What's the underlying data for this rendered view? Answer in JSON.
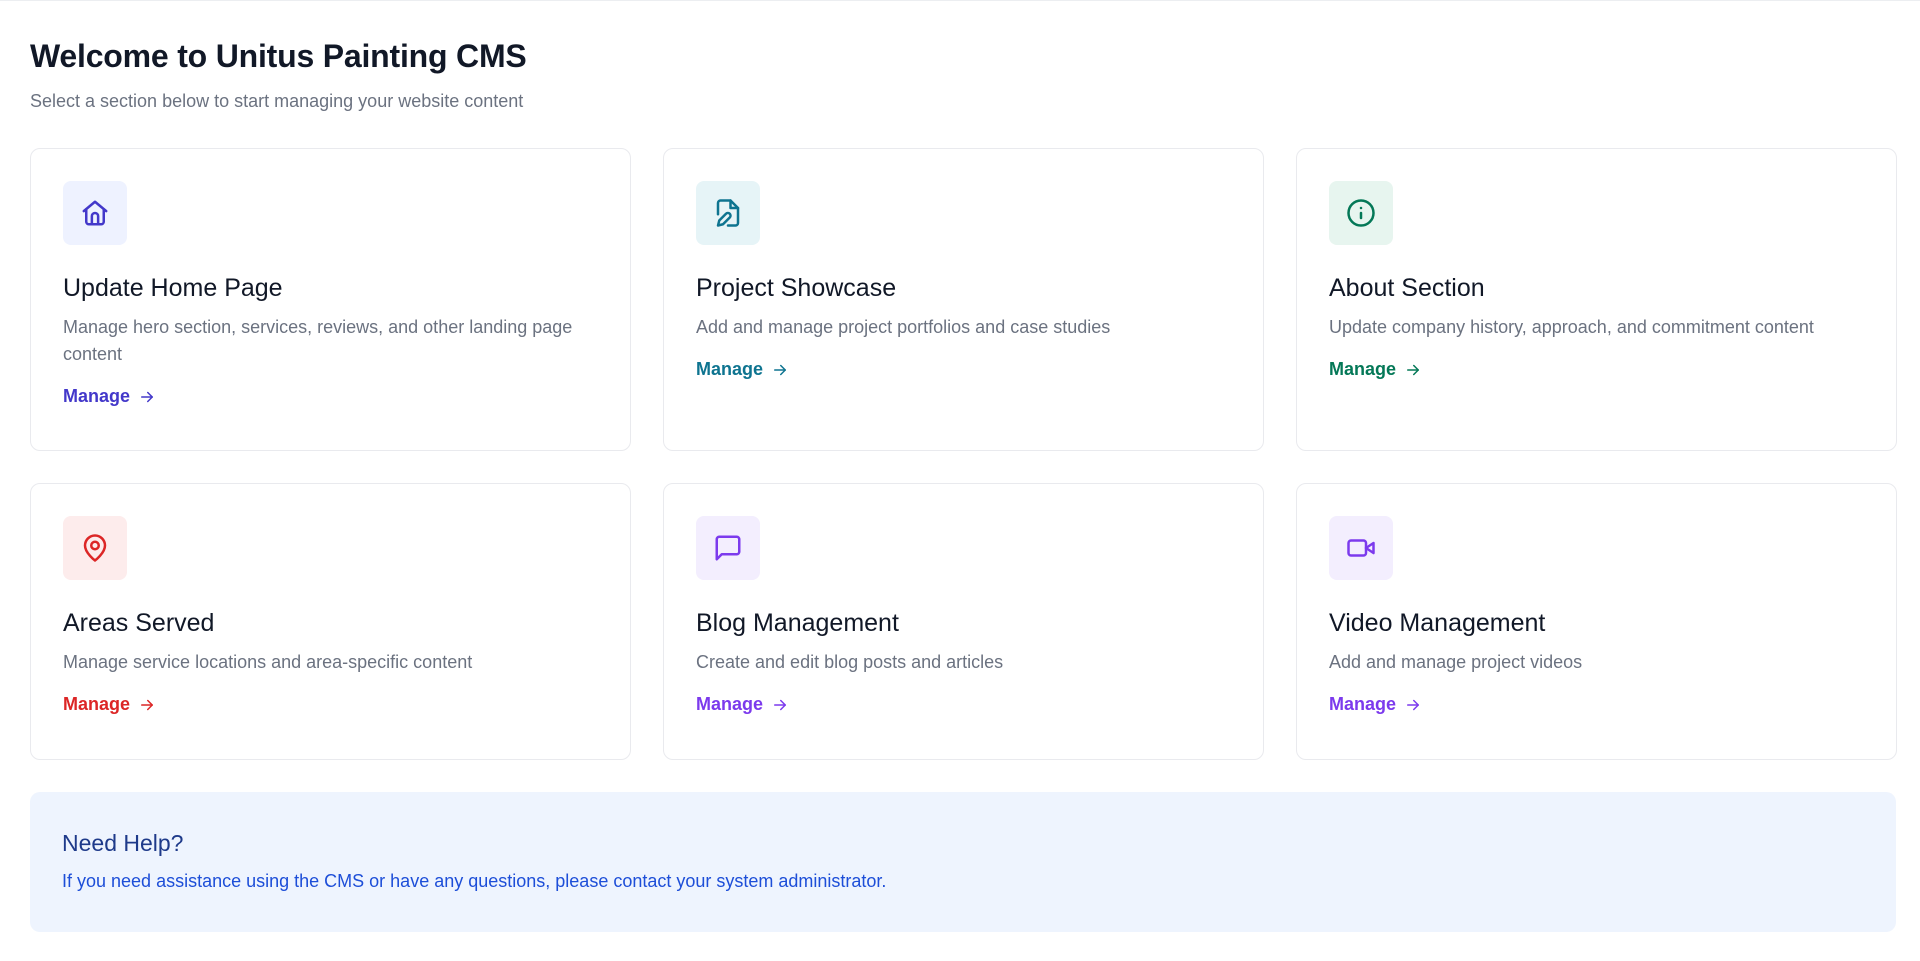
{
  "header": {
    "title": "Welcome to Unitus Painting CMS",
    "subtitle": "Select a section below to start managing your website content"
  },
  "cards": [
    {
      "icon": "home-icon",
      "title": "Update Home Page",
      "description": "Manage hero section, services, reviews, and other landing page content",
      "link": "Manage",
      "accent": "#4338ca",
      "icon_bg": "#eef2ff"
    },
    {
      "icon": "file-edit-icon",
      "title": "Project Showcase",
      "description": "Add and manage project portfolios and case studies",
      "link": "Manage",
      "accent": "#0e7490",
      "icon_bg": "#e6f4f7"
    },
    {
      "icon": "info-icon",
      "title": "About Section",
      "description": "Update company history, approach, and commitment content",
      "link": "Manage",
      "accent": "#047857",
      "icon_bg": "#e7f5ef"
    },
    {
      "icon": "map-pin-icon",
      "title": "Areas Served",
      "description": "Manage service locations and area-specific content",
      "link": "Manage",
      "accent": "#dc2626",
      "icon_bg": "#fdecec"
    },
    {
      "icon": "message-square-icon",
      "title": "Blog Management",
      "description": "Create and edit blog posts and articles",
      "link": "Manage",
      "accent": "#7c3aed",
      "icon_bg": "#f3eefe"
    },
    {
      "icon": "video-icon",
      "title": "Video Management",
      "description": "Add and manage project videos",
      "link": "Manage",
      "accent": "#7c3aed",
      "icon_bg": "#f3eefe"
    }
  ],
  "help": {
    "title": "Need Help?",
    "text": "If you need assistance using the CMS or have any questions, please contact your system administrator."
  }
}
